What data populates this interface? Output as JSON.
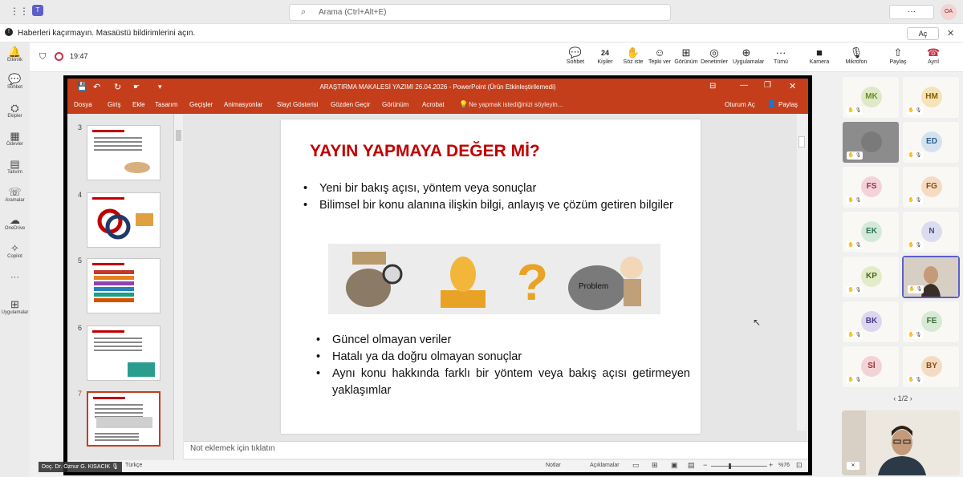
{
  "teams": {
    "search_placeholder": "Arama (Ctrl+Alt+E)",
    "more_label": "···",
    "user_initials": "OA",
    "notification_text": "Haberleri kaçırmayın. Masaüstü bildirimlerini açın.",
    "notification_button": "Aç",
    "rail": [
      {
        "label": "Etkinlik",
        "icon": "bell-icon"
      },
      {
        "label": "Sohbet",
        "icon": "chat-icon"
      },
      {
        "label": "Ekipler",
        "icon": "teams-icon"
      },
      {
        "label": "Ödevler",
        "icon": "assignments-icon"
      },
      {
        "label": "Takvim",
        "icon": "calendar-icon"
      },
      {
        "label": "Aramalar",
        "icon": "phone-icon"
      },
      {
        "label": "OneDrive",
        "icon": "cloud-icon"
      },
      {
        "label": "Copilot",
        "icon": "copilot-icon"
      },
      {
        "label": "···",
        "icon": "more-icon"
      },
      {
        "label": "Uygulamalar",
        "icon": "apps-icon"
      }
    ],
    "meeting_time": "19:47",
    "controls": [
      {
        "label": "Sohbet",
        "glyph": "💬"
      },
      {
        "label": "Kişiler",
        "glyph": "24"
      },
      {
        "label": "Söz iste",
        "glyph": "✋"
      },
      {
        "label": "Tepki ver",
        "glyph": "☺"
      },
      {
        "label": "Görünüm",
        "glyph": "⊞"
      },
      {
        "label": "Denetimler",
        "glyph": "◎"
      },
      {
        "label": "Uygulamalar",
        "glyph": "⊕"
      },
      {
        "label": "Tümü",
        "glyph": "···"
      },
      {
        "label": "Kamera",
        "glyph": "■"
      },
      {
        "label": "Mikrofon",
        "glyph": "🎙"
      },
      {
        "label": "Paylaş",
        "glyph": "⇧"
      },
      {
        "label": "Ayrıl",
        "glyph": "☎"
      }
    ],
    "participants": [
      {
        "initials": "MK",
        "color": "#6b8e23",
        "bg": "#dfe8c8"
      },
      {
        "initials": "HM",
        "color": "#8a5a00",
        "bg": "#f4e4b8"
      },
      {
        "initials": "",
        "color": "#555",
        "bg": "#9a9a9a"
      },
      {
        "initials": "ED",
        "color": "#2a5d8f",
        "bg": "#d4e2f0"
      },
      {
        "initials": "FS",
        "color": "#a0304a",
        "bg": "#f2d3da"
      },
      {
        "initials": "FG",
        "color": "#8a4a00",
        "bg": "#f4dcc4"
      },
      {
        "initials": "EK",
        "color": "#2f6f4f",
        "bg": "#d3ead9"
      },
      {
        "initials": "N",
        "color": "#4a4a8a",
        "bg": "#dcdcf0"
      },
      {
        "initials": "KP",
        "color": "#4a6a1a",
        "bg": "#e3ecc8"
      },
      {
        "initials": "",
        "color": "#555",
        "bg": "#cfc4b8"
      },
      {
        "initials": "BK",
        "color": "#4a3a8a",
        "bg": "#dcd6f0"
      },
      {
        "initials": "FE",
        "color": "#3a6a3a",
        "bg": "#d6ead6"
      },
      {
        "initials": "Sİ",
        "color": "#a0303a",
        "bg": "#f2d3d6"
      },
      {
        "initials": "BY",
        "color": "#8a4a10",
        "bg": "#f4dcc4"
      }
    ],
    "pager": "1/2",
    "presenter_name": "Doç. Dr. Öznur G. KISACIK"
  },
  "ppt": {
    "title": "ARAŞTIRMA MAKALESİ YAZIMI 26.04.2026 - PowerPoint (Ürün Etkinleştirilemedi)",
    "ribbon_tabs": [
      "Dosya",
      "Giriş",
      "Ekle",
      "Tasarım",
      "Geçişler",
      "Animasyonlar",
      "Slayt Gösterisi",
      "Gözden Geçir",
      "Görünüm",
      "Acrobat"
    ],
    "tell_me": "Ne yapmak istediğinizi söyleyin...",
    "sign_in": "Oturum Aç",
    "share": "Paylaş",
    "thumb_numbers": [
      "3",
      "4",
      "5",
      "6",
      "7"
    ],
    "slide": {
      "title": "YAYIN YAPMAYA DEĞER Mİ?",
      "bullets_top": [
        "Yeni bir bakış açısı, yöntem veya sonuçlar",
        "Bilimsel bir konu alanına ilişkin bilgi, anlayış  ve çözüm getiren bilgiler"
      ],
      "bullets_bottom": [
        "Güncel olmayan veriler",
        "Hatalı ya da doğru olmayan sonuçlar",
        "Aynı konu hakkında farklı bir yöntem veya bakış açısı getirmeyen yaklaşımlar"
      ],
      "problem_label": "Problem"
    },
    "notes_placeholder": "Not eklemek için tıklatın",
    "status_language": "Türkçe",
    "status_notes": "Notlar",
    "status_comments": "Açıklamalar",
    "zoom": "%76"
  },
  "colors": {
    "ppt_red": "#c43e1c",
    "slide_title": "#c00000",
    "teams_purple": "#5b5fc7"
  }
}
